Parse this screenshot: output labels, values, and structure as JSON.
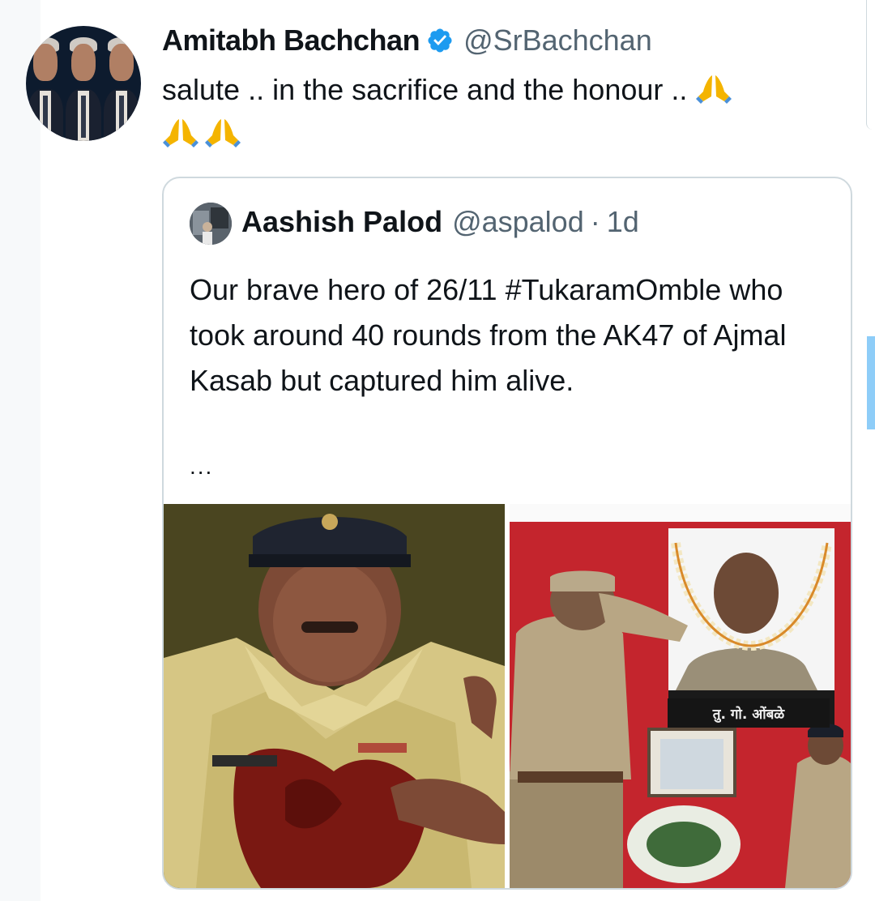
{
  "tweet": {
    "author": {
      "name": "Amitabh Bachchan",
      "handle": "@SrBachchan",
      "verified": true
    },
    "text": "salute .. in the sacrifice and the honour ..",
    "emoji": [
      "folded-hands",
      "folded-hands",
      "folded-hands"
    ]
  },
  "quoted_tweet": {
    "author": {
      "name": "Aashish Palod",
      "handle": "@aspalod"
    },
    "separator": "·",
    "time": "1d",
    "text": "Our brave hero of 26/11 #TukaramOmble who took around 40 rounds from the AK47 of Ajmal Kasab but captured him alive.",
    "more": "...",
    "media": [
      {
        "kind": "photo",
        "description_icon": "photo"
      },
      {
        "kind": "photo",
        "description_icon": "photo",
        "board_caption": "तु. गो. ओंबळे"
      }
    ]
  },
  "colors": {
    "verified": "#1d9bf0",
    "secondary_text": "#536471",
    "border": "#cfd9de",
    "scroll": "#8ecdf8"
  }
}
